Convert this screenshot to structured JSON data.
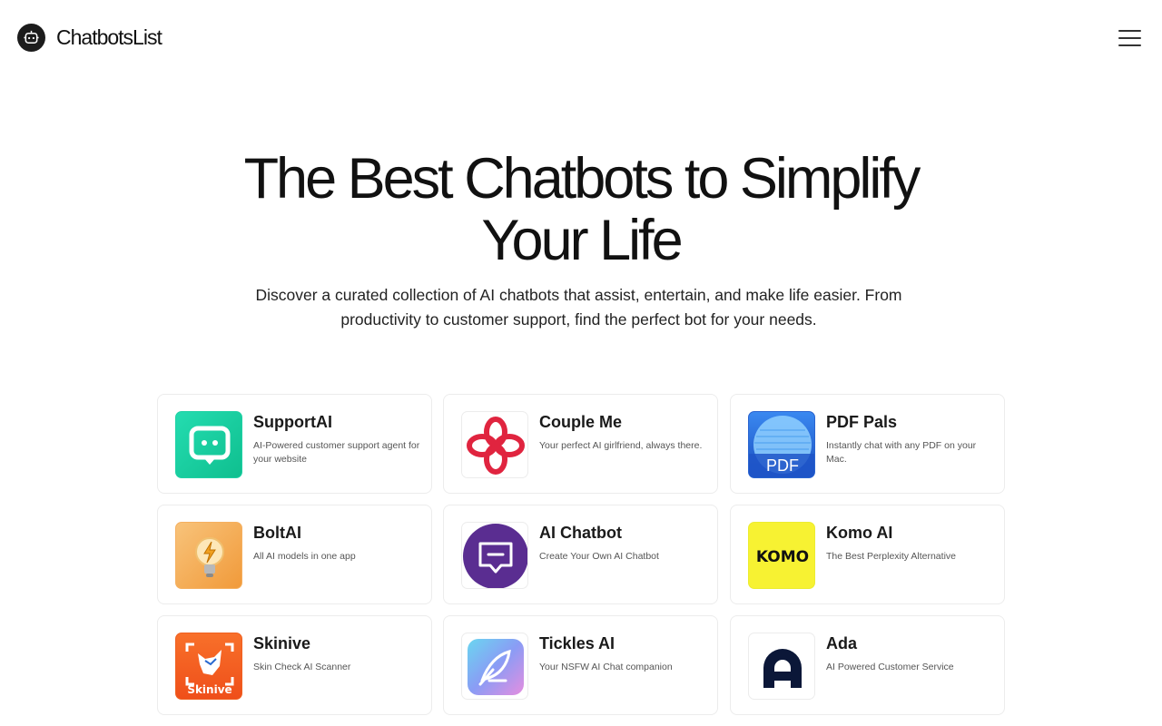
{
  "header": {
    "brand_name": "ChatbotsList",
    "logo_icon": "robot-icon",
    "menu_icon": "hamburger-menu-icon"
  },
  "hero": {
    "title_line1": "The Best Chatbots to Simplify",
    "title_line2": "Your Life",
    "subtitle_line1": "Discover a curated collection of AI chatbots that assist, entertain, and make life easier. From",
    "subtitle_line2": "productivity to customer support, find the perfect bot for your needs."
  },
  "chatbots": [
    {
      "name": "SupportAI",
      "description": "AI-Powered customer support agent for your website",
      "icon": "chat-bubble-icon",
      "color": "#1ccfa0"
    },
    {
      "name": "Couple Me",
      "description": "Your perfect AI girlfriend, always there.",
      "icon": "knot-icon",
      "color": "#e0243f"
    },
    {
      "name": "PDF Pals",
      "description": "Instantly chat with any PDF on your Mac.",
      "icon": "pdf-icon",
      "color": "#1f64d6"
    },
    {
      "name": "BoltAI",
      "description": "All AI models in one app",
      "icon": "lightbulb-icon",
      "color": "#f5a54a"
    },
    {
      "name": "AI Chatbot",
      "description": "Create Your Own AI Chatbot",
      "icon": "message-bubble-icon",
      "color": "#5a2d91"
    },
    {
      "name": "Komo AI",
      "description": "The Best Perplexity Alternative",
      "icon": "komo-logo-icon",
      "color": "#f7f232"
    },
    {
      "name": "Skinive",
      "description": "Skin Check AI Scanner",
      "icon": "skinive-logo-icon",
      "color": "#f25a1e"
    },
    {
      "name": "Tickles AI",
      "description": "Your NSFW AI Chat companion",
      "icon": "feather-icon",
      "color": "#7fa2f0"
    },
    {
      "name": "Ada",
      "description": "AI Powered Customer Service",
      "icon": "ada-logo-icon",
      "color": "#0b1738"
    }
  ],
  "icon_text": {
    "pdf_pals": "PDF",
    "komo": "KOMO",
    "skinive": "Skinive"
  }
}
